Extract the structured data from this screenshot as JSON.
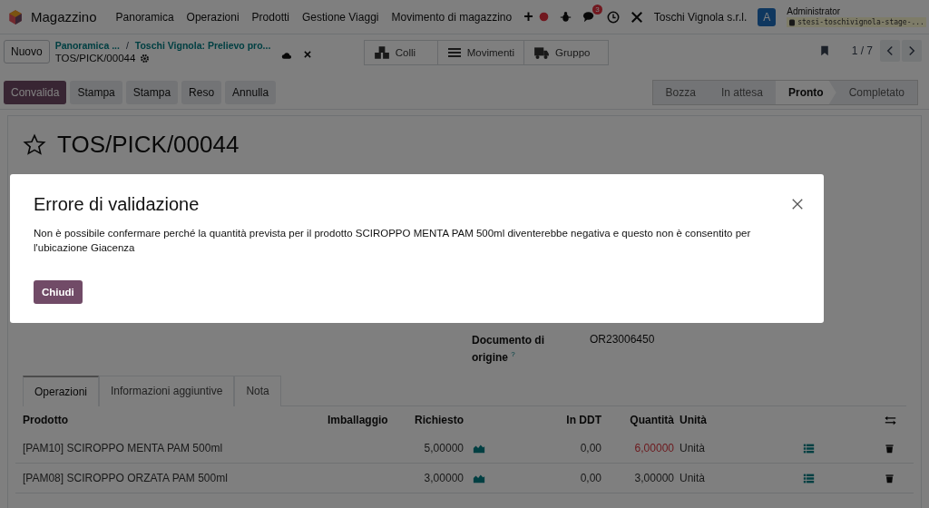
{
  "navbar": {
    "app_name": "Magazzino",
    "menu": [
      "Panoramica",
      "Operazioni",
      "Prodotti",
      "Gestione Viaggi",
      "Movimento di magazzino"
    ],
    "add_symbol": "+",
    "message_count": "3",
    "company": "Toschi Vignola s.r.l.",
    "avatar_letter": "A",
    "user": "Administrator",
    "database": "stesi-toschivignola-stage-..."
  },
  "control_panel": {
    "new_button": "Nuovo",
    "breadcrumbs": [
      "Panoramica ...",
      "Toschi Vignola: Prelievo pro..."
    ],
    "separator": "/",
    "record": "TOS/PICK/00044",
    "smart_buttons": [
      {
        "kind": "boxes",
        "label": "Colli"
      },
      {
        "kind": "list",
        "label": "Movimenti"
      },
      {
        "kind": "truck",
        "label": "Gruppo"
      }
    ],
    "pager": "1 / 7"
  },
  "actions": [
    {
      "kind": "primary",
      "label": "Convalida"
    },
    {
      "kind": "secondary",
      "label": "Stampa"
    },
    {
      "kind": "secondary",
      "label": "Stampa"
    },
    {
      "kind": "secondary",
      "label": "Reso"
    },
    {
      "kind": "secondary",
      "label": "Annulla"
    }
  ],
  "status_steps": [
    {
      "label": "Bozza",
      "selected": false
    },
    {
      "label": "In attesa",
      "selected": false
    },
    {
      "label": "Pronto",
      "selected": true
    },
    {
      "label": "Completato",
      "selected": false
    }
  ],
  "form": {
    "title": "TOS/PICK/00044",
    "starred": false,
    "fields": [
      {
        "label": "Documento di origine",
        "help": "?",
        "value": "OR23006450"
      }
    ]
  },
  "tabs": [
    {
      "label": "Operazioni",
      "selected": true
    },
    {
      "label": "Informazioni aggiuntive",
      "selected": false
    },
    {
      "label": "Nota",
      "selected": false
    }
  ],
  "table": {
    "columns": {
      "product": "Prodotto",
      "packaging": "Imballaggio",
      "requested": "Richiesto",
      "in_ddt": "In DDT",
      "quantity": "Quantità",
      "unit": "Unità"
    },
    "rows": [
      {
        "product": "[PAM10] SCIROPPO MENTA PAM 500ml",
        "requested": "5,00000",
        "in_ddt": "0,00",
        "quantity": "6,00000",
        "quantity_warning": true,
        "unit": "Unità"
      },
      {
        "product": "[PAM08] SCIROPPO ORZATA PAM 500ml",
        "requested": "3,00000",
        "in_ddt": "0,00",
        "quantity": "3,00000",
        "quantity_warning": false,
        "unit": "Unità"
      }
    ]
  },
  "dialog": {
    "title": "Errore di validazione",
    "message": "Non è possibile confermare perché la quantità prevista per il prodotto SCIROPPO MENTA PAM 500ml diventerebbe negativa e questo non è consentito per l'ubicazione Giacenza",
    "button": "Chiudi"
  }
}
